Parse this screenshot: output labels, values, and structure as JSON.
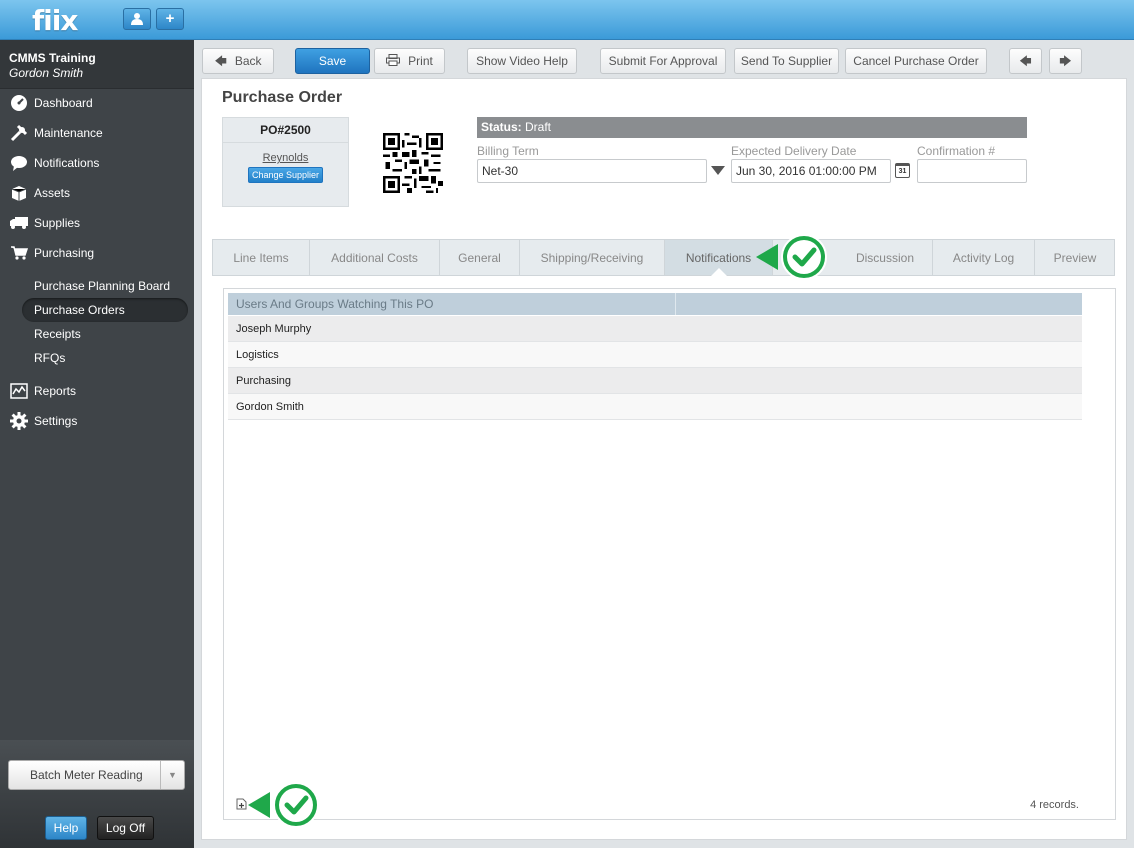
{
  "app": {
    "logo": "fiix"
  },
  "topbar": {
    "user_icon": "user-icon",
    "add_icon": "plus-icon",
    "add_label": "+"
  },
  "sidebar": {
    "org": "CMMS Training",
    "user": "Gordon Smith",
    "nav": [
      {
        "label": "Dashboard",
        "icon": "dashboard-icon"
      },
      {
        "label": "Maintenance",
        "icon": "wrench-icon"
      },
      {
        "label": "Notifications",
        "icon": "speech-bubble-icon"
      },
      {
        "label": "Assets",
        "icon": "box-icon"
      },
      {
        "label": "Supplies",
        "icon": "truck-icon"
      },
      {
        "label": "Purchasing",
        "icon": "cart-icon"
      }
    ],
    "sub": [
      "Purchase Planning Board",
      "Purchase Orders",
      "Receipts",
      "RFQs"
    ],
    "nav2": [
      {
        "label": "Reports",
        "icon": "chart-icon"
      },
      {
        "label": "Settings",
        "icon": "gear-icon"
      }
    ],
    "batch_label": "Batch Meter Reading",
    "help": "Help",
    "logoff": "Log Off"
  },
  "toolbar": {
    "back": "Back",
    "save": "Save",
    "print": "Print",
    "video": "Show Video Help",
    "submit": "Submit For Approval",
    "send": "Send To Supplier",
    "cancel": "Cancel Purchase Order"
  },
  "po": {
    "title": "Purchase Order",
    "number": "PO#2500",
    "supplier": "Reynolds",
    "change_supplier": "Change Supplier",
    "status_label": "Status:",
    "status_value": "Draft",
    "billing_label": "Billing Term",
    "billing_value": "Net-30",
    "delivery_label": "Expected Delivery Date",
    "delivery_value": "Jun 30, 2016 01:00:00 PM",
    "calendar_day": "31",
    "confirm_label": "Confirmation #",
    "confirm_value": ""
  },
  "tabs": [
    "Line Items",
    "Additional Costs",
    "General",
    "Shipping/Receiving",
    "Notifications",
    "Discussion",
    "Activity Log",
    "Preview"
  ],
  "active_tab": "Notifications",
  "grid": {
    "header": "Users And Groups Watching This PO",
    "rows": [
      "Joseph Murphy",
      "Logistics",
      "Purchasing",
      "Gordon Smith"
    ],
    "records": "4 records."
  },
  "colors": {
    "accent": "#2d86c8",
    "callout": "#22b14c"
  }
}
